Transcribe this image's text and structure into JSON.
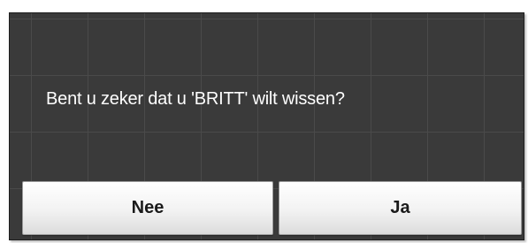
{
  "dialog": {
    "message": "Bent u zeker dat u 'BRITT' wilt wissen?",
    "buttons": {
      "no_label": "Nee",
      "yes_label": "Ja"
    }
  },
  "colors": {
    "dialog_background": "#3a3a3a",
    "grid_lines": "#4a4a4a",
    "message_text": "#ffffff",
    "button_text": "#1a1a1a"
  }
}
